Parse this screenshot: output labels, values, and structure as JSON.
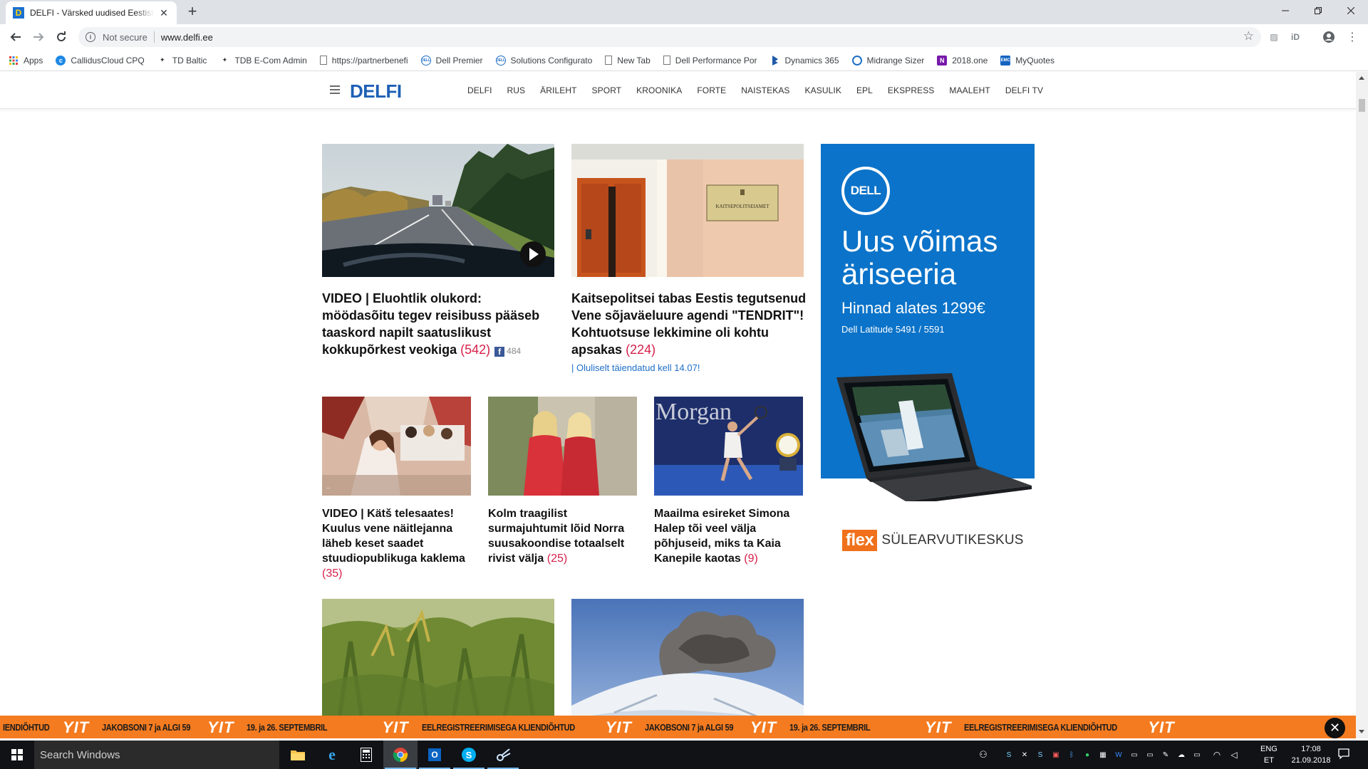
{
  "browser": {
    "tab_title": "DELFI - Värsked uudised Eestist ja",
    "tab_favicon": "D",
    "not_secure": "Not secure",
    "url": "www.delfi.ee",
    "colors": {
      "tab_strip": "#dee1e6",
      "omnibox": "#f1f3f4"
    }
  },
  "bookmarks": [
    {
      "label": "Apps",
      "icon": "apps-icon"
    },
    {
      "label": "CallidusCloud CPQ",
      "icon": "callidus-icon"
    },
    {
      "label": "TD Baltic",
      "icon": "td-icon"
    },
    {
      "label": "TDB E-Com Admin",
      "icon": "td-icon"
    },
    {
      "label": "https://partnerbenefi",
      "icon": "page-icon"
    },
    {
      "label": "Dell Premier",
      "icon": "dell-icon"
    },
    {
      "label": "Solutions Configurato",
      "icon": "dell-icon"
    },
    {
      "label": "New Tab",
      "icon": "page-icon"
    },
    {
      "label": "Dell Performance Por",
      "icon": "page-icon"
    },
    {
      "label": "Dynamics 365",
      "icon": "dynamics-icon"
    },
    {
      "label": "Midrange Sizer",
      "icon": "sizer-icon"
    },
    {
      "label": "2018.one",
      "icon": "onenote-icon"
    },
    {
      "label": "MyQuotes",
      "icon": "emc-icon"
    }
  ],
  "site": {
    "logo": "DELFI",
    "brand_color": "#1e5fb5",
    "comment_color": "#d6204a",
    "nav": [
      "DELFI",
      "RUS",
      "ÄRILEHT",
      "SPORT",
      "KROONIKA",
      "FORTE",
      "NAISTEKAS",
      "KASULIK",
      "EPL",
      "EKSPRESS",
      "MAALEHT",
      "DELFI TV"
    ]
  },
  "articles": {
    "a1": {
      "title": "VIDEO | Eluohtlik olukord: möödasõitu tegev reisibuss pääseb taaskord napilt saatuslikust kokkupõrkest veokiga",
      "comments": "(542)",
      "fb_count": "484"
    },
    "a2": {
      "title": "Kaitsepolitsei tabas Eestis tegutsenud Vene sõjaväeluure agendi \"TENDRIT\"! Kohtuotsuse lekkimine oli kohtu apsakas",
      "comments": "(224)",
      "update": "| Oluliselt täiendatud kell 14.07!",
      "sign": "KAITSEPOLITSEIAMET"
    },
    "a3": {
      "title": "VIDEO | Kätš telesaates! Kuulus vene näitlejanna läheb keset saadet stuudiopublikuga kaklema",
      "comments": "(35)"
    },
    "a4": {
      "title": "Kolm traagilist surmajuhtumit lõid Norra suusakoondise totaalselt rivist välja",
      "comments": "(25)"
    },
    "a5": {
      "title": "Maailma esireket Simona Halep tõi veel välja põhjuseid, miks ta Kaia Kanepile kaotas",
      "comments": "(9)",
      "sign": "Morgan"
    }
  },
  "ad": {
    "logo": "DELL",
    "title": "Uus võimas äriseeria",
    "price": "Hinnad alates 1299€",
    "model": "Dell Latitude 5491 / 5591",
    "bg_color": "#0b73c9",
    "partner_logo": "flex",
    "partner_text": "SÜLEARVUTIKESKUS"
  },
  "ticker": {
    "items": [
      "IENDIÕHTUD",
      "JAKOBSONI 7 ja ALGI 59",
      "19. ja 26. SEPTEMBRIL",
      "EELREGISTREERIMISEGA KLIENDIÕHTUD",
      "JAKOBSONI 7 ja ALGI 59",
      "19. ja 26. SEPTEMBRIL",
      "EELREGISTREERIMISEGA KLIENDIÕHTUD"
    ],
    "logo": "YIT",
    "color": "#f47b20"
  },
  "taskbar": {
    "search_placeholder": "Search Windows",
    "lang_line1": "ENG",
    "lang_line2": "ET",
    "time": "17:08",
    "date": "21.09.2018"
  }
}
